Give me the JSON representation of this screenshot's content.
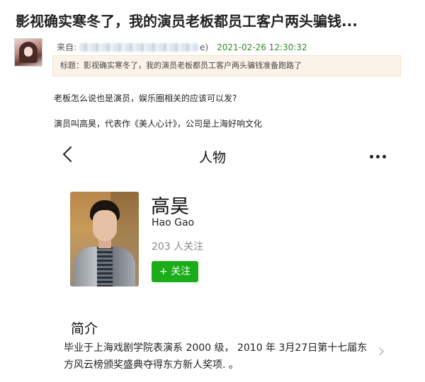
{
  "post": {
    "title": "影视确实寒冬了，我的演员老板都员工客户两头骗钱...",
    "from_label": "来自:",
    "from_tail": "e)",
    "datetime": "2021-02-26 12:30:32",
    "subject": "标题：影视确实寒冬了，我的演员老板都员工客户两头骗钱准备跑路了",
    "paragraphs": [
      "老板怎么说也是演员，娱乐圈相关的应该可以发?",
      "演员叫高昊，代表作《美人心计》，公司是上海好响文化"
    ]
  },
  "profile_page": {
    "nav_title": "人物",
    "name": "高昊",
    "english_name": "Hao Gao",
    "followers": "203 人关注",
    "follow_button": "+ 关注",
    "intro_heading": "简介",
    "intro_text": "毕业于上海戏剧学院表演系 2000 级， 2010 年 3月27日第十七届东方风云榜颁奖盛典夺得东方新人奖项. 。"
  },
  "colors": {
    "follow_green": "#1aad19",
    "date_green": "#2e8b2e",
    "subject_bg": "#fbf3e8"
  },
  "icons": {
    "back": "chevron-left-icon",
    "more": "more-dots-icon",
    "expand": "chevron-right-icon"
  }
}
